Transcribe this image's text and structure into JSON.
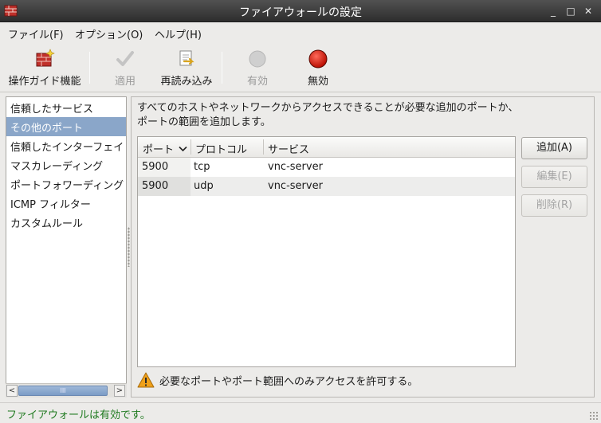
{
  "window": {
    "title": "ファイアウォールの設定",
    "controls": [
      "minimize-icon",
      "maximize-icon",
      "close-icon"
    ]
  },
  "menubar": {
    "items": [
      "ファイル(F)",
      "オプション(O)",
      "ヘルプ(H)"
    ]
  },
  "toolbar": {
    "buttons": [
      {
        "label": "操作ガイド機能",
        "icon": "wizard-icon",
        "enabled": true
      },
      {
        "label": "適用",
        "icon": "apply-check-icon",
        "enabled": false
      },
      {
        "label": "再読み込み",
        "icon": "reload-icon",
        "enabled": true
      },
      {
        "label": "有効",
        "icon": "enable-icon",
        "enabled": false
      },
      {
        "label": "無効",
        "icon": "disable-icon",
        "enabled": true
      }
    ]
  },
  "sidebar": {
    "items": [
      {
        "label": "信頼したサービス",
        "selected": false
      },
      {
        "label": "その他のポート",
        "selected": true
      },
      {
        "label": "信頼したインターフェイ",
        "selected": false
      },
      {
        "label": "マスカレーディング",
        "selected": false
      },
      {
        "label": "ポートフォワーディング",
        "selected": false
      },
      {
        "label": "ICMP フィルター",
        "selected": false
      },
      {
        "label": "カスタムルール",
        "selected": false
      }
    ],
    "scrollbar": {
      "left_arrow": "<",
      "right_arrow": ">",
      "thumb_grip": "III"
    }
  },
  "main": {
    "description": "すべてのホストやネットワークからアクセスできることが必要な追加のポートか、ポートの範囲を追加します。",
    "table": {
      "columns": [
        "ポート",
        "プロトコル",
        "サービス"
      ],
      "sort_indicator": "chevron-down-icon",
      "rows": [
        {
          "port": "5900",
          "protocol": "tcp",
          "service": "vnc-server"
        },
        {
          "port": "5900",
          "protocol": "udp",
          "service": "vnc-server"
        }
      ]
    },
    "buttons": [
      {
        "label": "追加(A)",
        "enabled": true
      },
      {
        "label": "編集(E)",
        "enabled": false
      },
      {
        "label": "削除(R)",
        "enabled": false
      }
    ],
    "warning": {
      "icon": "warning-icon",
      "text": "必要なポートやポート範囲へのみアクセスを許可する。"
    }
  },
  "statusbar": {
    "text": "ファイアウォールは有効です。",
    "color": "#1f7a1f"
  },
  "colors": {
    "selection": "#8aa6c9",
    "titlebar": "#3a3a3a",
    "background": "#ecebe9"
  }
}
